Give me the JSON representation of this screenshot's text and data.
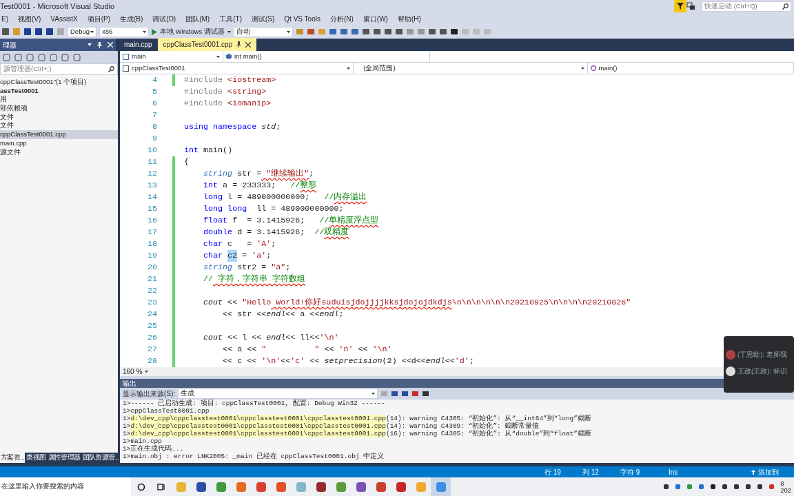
{
  "window": {
    "title": "Test0001 - Microsoft Visual Studio"
  },
  "quick_launch": {
    "placeholder": "快速启动 (Ctrl+Q)"
  },
  "menu": [
    "E)",
    "视图(V)",
    "VAssistX",
    "项目(P)",
    "生成(B)",
    "调试(D)",
    "团队(M)",
    "工具(T)",
    "测试(S)",
    "Qt VS Tools",
    "分析(N)",
    "窗口(W)",
    "帮助(H)"
  ],
  "toolbar": {
    "configuration": "Debug",
    "platform": "x86",
    "run_button": "本地 Windows 调试器",
    "run_mode": "自动"
  },
  "solution_explorer": {
    "title": "理器",
    "search_placeholder": "源管理器(Ctrl+;)",
    "items": [
      {
        "label": "cppClassTest0001\"(1 个项目)",
        "bold": false,
        "selected": false
      },
      {
        "label": "assTest0001",
        "bold": true,
        "selected": false
      },
      {
        "label": "用",
        "bold": false,
        "selected": false
      },
      {
        "label": "部依赖项",
        "bold": false,
        "selected": false
      },
      {
        "label": "文件",
        "bold": false,
        "selected": false
      },
      {
        "label": "文件",
        "bold": false,
        "selected": false
      },
      {
        "label": "cppClassTest0001.cpp",
        "bold": false,
        "selected": true
      },
      {
        "label": "main.cpp",
        "bold": false,
        "selected": false
      },
      {
        "label": "源文件",
        "bold": false,
        "selected": false
      }
    ],
    "bottom_tabs": [
      {
        "label": "方案资...",
        "selected": true
      },
      {
        "label": "类视图",
        "selected": false
      },
      {
        "label": "属性管理器",
        "selected": false
      },
      {
        "label": "团队资源管...",
        "selected": false
      }
    ]
  },
  "editor": {
    "tabs": [
      {
        "label": "main.cpp",
        "selected": false
      },
      {
        "label": "cppClassTest0001.cpp",
        "selected": true
      }
    ],
    "nav": {
      "scope": "main",
      "member": "int main()",
      "project": "cppClassTest0001",
      "range": "(全局范围)",
      "function": "main()"
    },
    "lines": [
      {
        "number": "4",
        "changed": true,
        "tokens": [
          {
            "t": "#include",
            "kind": "pp"
          },
          {
            "t": " <iostream>",
            "kind": "inc"
          }
        ]
      },
      {
        "number": "5",
        "changed": false,
        "tokens": [
          {
            "t": "#include",
            "kind": "pp"
          },
          {
            "t": " <string>",
            "kind": "inc"
          }
        ]
      },
      {
        "number": "6",
        "changed": false,
        "tokens": [
          {
            "t": "#include",
            "kind": "pp"
          },
          {
            "t": " <iomanip>",
            "kind": "inc"
          }
        ]
      },
      {
        "number": "7",
        "changed": false
      },
      {
        "number": "8",
        "changed": false,
        "tokens": [
          {
            "t": "using namespace",
            "kind": "kw"
          },
          {
            "t": " std",
            "kind": "id"
          },
          {
            "t": ";",
            "kind": "p"
          }
        ]
      },
      {
        "number": "9",
        "changed": false
      },
      {
        "number": "10",
        "changed": false,
        "tokens": [
          {
            "t": "int",
            "kind": "kw"
          },
          {
            "t": " main()",
            "kind": "p"
          }
        ]
      },
      {
        "number": "11",
        "changed": true,
        "tokens": [
          {
            "t": "{",
            "kind": "p"
          }
        ]
      },
      {
        "number": "12",
        "changed": true,
        "tokens": [
          {
            "t": "    string",
            "kind": "type"
          },
          {
            "t": " str =",
            "kind": "p"
          },
          {
            "t": " \"继续输出\"",
            "kind": "str",
            "sq": true
          },
          {
            "t": ";",
            "kind": "p"
          }
        ]
      },
      {
        "number": "13",
        "changed": true,
        "tokens": [
          {
            "t": "    int",
            "kind": "kw"
          },
          {
            "t": " a = 233333;",
            "kind": "p"
          },
          {
            "t": "   //",
            "kind": "cmt"
          },
          {
            "t": "整形",
            "kind": "cmt",
            "sq": true
          }
        ]
      },
      {
        "number": "14",
        "changed": true,
        "tokens": [
          {
            "t": "    long",
            "kind": "kw"
          },
          {
            "t": " l = 489000000000;",
            "kind": "p"
          },
          {
            "t": "   //",
            "kind": "cmt"
          },
          {
            "t": "内存溢出",
            "kind": "cmt",
            "sq": true
          }
        ]
      },
      {
        "number": "15",
        "changed": true,
        "tokens": [
          {
            "t": "    long long",
            "kind": "kw"
          },
          {
            "t": "  ll = 489000000000;",
            "kind": "p"
          }
        ]
      },
      {
        "number": "16",
        "changed": true,
        "tokens": [
          {
            "t": "    float",
            "kind": "kw"
          },
          {
            "t": " f  = 3.1415926;",
            "kind": "p"
          },
          {
            "t": "   //",
            "kind": "cmt"
          },
          {
            "t": "单精度浮点型",
            "kind": "cmt",
            "sq": true
          }
        ]
      },
      {
        "number": "17",
        "changed": true,
        "tokens": [
          {
            "t": "    double",
            "kind": "kw"
          },
          {
            "t": " d = 3.1415926;",
            "kind": "p"
          },
          {
            "t": "  //",
            "kind": "cmt"
          },
          {
            "t": "双精度",
            "kind": "cmt",
            "sq": true
          }
        ]
      },
      {
        "number": "18",
        "changed": true,
        "tokens": [
          {
            "t": "    char",
            "kind": "kw"
          },
          {
            "t": " c   =",
            "kind": "p"
          },
          {
            "t": " 'A'",
            "kind": "str"
          },
          {
            "t": ";",
            "kind": "p"
          }
        ]
      },
      {
        "number": "19",
        "changed": true,
        "tokens": [
          {
            "t": "    char ",
            "kind": "kw"
          },
          {
            "t": "c2",
            "kind": "sel"
          },
          {
            "t": " =",
            "kind": "p"
          },
          {
            "t": " 'a'",
            "kind": "str"
          },
          {
            "t": ";",
            "kind": "p"
          }
        ]
      },
      {
        "number": "20",
        "changed": true,
        "tokens": [
          {
            "t": "    string",
            "kind": "type"
          },
          {
            "t": " str2 =",
            "kind": "p"
          },
          {
            "t": " \"a\"",
            "kind": "str"
          },
          {
            "t": ";",
            "kind": "p"
          }
        ]
      },
      {
        "number": "21",
        "changed": true,
        "tokens": [
          {
            "t": "    //",
            "kind": "cmt"
          },
          {
            "t": " 字符，字符串 字符数组",
            "kind": "cmt",
            "sq": true
          }
        ]
      },
      {
        "number": "22",
        "changed": true
      },
      {
        "number": "23",
        "changed": true,
        "tokens": [
          {
            "t": "    cout",
            "kind": "id"
          },
          {
            "t": " <<",
            "kind": "p"
          },
          {
            "t": " \"Hello",
            "kind": "str"
          },
          {
            "t": " World!你好suduisjdojjjjkksjdojojdkdjs",
            "kind": "str",
            "sq": true
          },
          {
            "t": "\\n\\n\\n\\n\\n\\n20210925\\n\\n\\n\\n20210826\"",
            "kind": "str"
          }
        ]
      },
      {
        "number": "24",
        "changed": true,
        "tokens": [
          {
            "t": "        << str <<",
            "kind": "p"
          },
          {
            "t": "endl",
            "kind": "id"
          },
          {
            "t": "<< a <<",
            "kind": "p"
          },
          {
            "t": "endl",
            "kind": "id"
          },
          {
            "t": ";",
            "kind": "p"
          }
        ]
      },
      {
        "number": "25",
        "changed": true
      },
      {
        "number": "26",
        "changed": true,
        "tokens": [
          {
            "t": "    cout",
            "kind": "id"
          },
          {
            "t": " << l <<",
            "kind": "p"
          },
          {
            "t": " endl",
            "kind": "id"
          },
          {
            "t": "<< ll<<",
            "kind": "p"
          },
          {
            "t": "'\\n'",
            "kind": "str"
          }
        ]
      },
      {
        "number": "27",
        "changed": true,
        "tokens": [
          {
            "t": "        << a <<",
            "kind": "p"
          },
          {
            "t": " \"          \"",
            "kind": "str"
          },
          {
            "t": " <<",
            "kind": "p"
          },
          {
            "t": " 'n'",
            "kind": "str"
          },
          {
            "t": " <<",
            "kind": "p"
          },
          {
            "t": " '\\n'",
            "kind": "str"
          }
        ]
      },
      {
        "number": "28",
        "changed": true,
        "tokens": [
          {
            "t": "        << c <<",
            "kind": "p"
          },
          {
            "t": " '\\n'",
            "kind": "str"
          },
          {
            "t": "<<",
            "kind": "p"
          },
          {
            "t": "'c'",
            "kind": "str"
          },
          {
            "t": " <<",
            "kind": "p"
          },
          {
            "t": " setprecision",
            "kind": "id"
          },
          {
            "t": "(2) <<d<<",
            "kind": "p"
          },
          {
            "t": "endl",
            "kind": "id"
          },
          {
            "t": "<<",
            "kind": "p"
          },
          {
            "t": "'d'",
            "kind": "str"
          },
          {
            "t": ";",
            "kind": "p"
          }
        ]
      }
    ],
    "zoom": "160 %"
  },
  "output": {
    "title": "输出",
    "source_label": "显示输出来源(S):",
    "source": "生成",
    "lines": [
      {
        "text": "1>------ 已启动生成: 项目: cppClassTest0001, 配置: Debug Win32 ------"
      },
      {
        "text": "1>cppClassTest0001.cpp"
      },
      {
        "prefix": "1>",
        "link": "d:\\dev_cpp\\cppclasstest0001\\cppclasstest0001\\cppclasstest0001.cpp",
        "text": "(14): warning C4305: “初始化”: 从“__int64”到“long”截断"
      },
      {
        "prefix": "1>",
        "link": "d:\\dev_cpp\\cppclasstest0001\\cppclasstest0001\\cppclasstest0001.cpp",
        "text": "(14): warning C4309: “初始化”: 截断常量值"
      },
      {
        "prefix": "1>",
        "link": "d:\\dev_cpp\\cppclasstest0001\\cppclasstest0001\\cppclasstest0001.cpp",
        "text": "(16): warning C4305: “初始化”: 从“double”到“float”截断"
      },
      {
        "text": "1>main.cpp"
      },
      {
        "text": "1>正在生成代码..."
      },
      {
        "text": "1>main.obj : error LNK2005: _main 已经在 cppClassTest0001.obj 中定义"
      }
    ]
  },
  "status_bar": {
    "line": "行 19",
    "column": "列 12",
    "char": "字符 9",
    "mode": "Ins",
    "publish": "添加到"
  },
  "taskbar": {
    "search_placeholder": "在这里输入你要搜索的内容",
    "apps": [
      {
        "color": "#e8b533",
        "selected": false
      },
      {
        "color": "#2d4fa8",
        "selected": false
      },
      {
        "color": "#3c9a3c",
        "selected": false
      },
      {
        "color": "#e66a1f",
        "selected": false
      },
      {
        "color": "#d9402f",
        "selected": false
      },
      {
        "color": "#e34f26",
        "selected": false
      },
      {
        "color": "#7fb8c8",
        "selected": false
      },
      {
        "color": "#9b2b2b",
        "selected": false
      },
      {
        "color": "#5a9b3a",
        "selected": false
      },
      {
        "color": "#7b4fb5",
        "selected": false
      },
      {
        "color": "#c9412a",
        "selected": false
      },
      {
        "color": "#c62828",
        "selected": false
      },
      {
        "color": "#f0a830",
        "selected": false
      },
      {
        "color": "#3a8ee6",
        "selected": true
      }
    ],
    "clock": [
      "8",
      "202"
    ]
  },
  "chat": [
    {
      "text": "(丁思欧): 老师我"
    },
    {
      "text": "王政(王政): 标识"
    }
  ]
}
